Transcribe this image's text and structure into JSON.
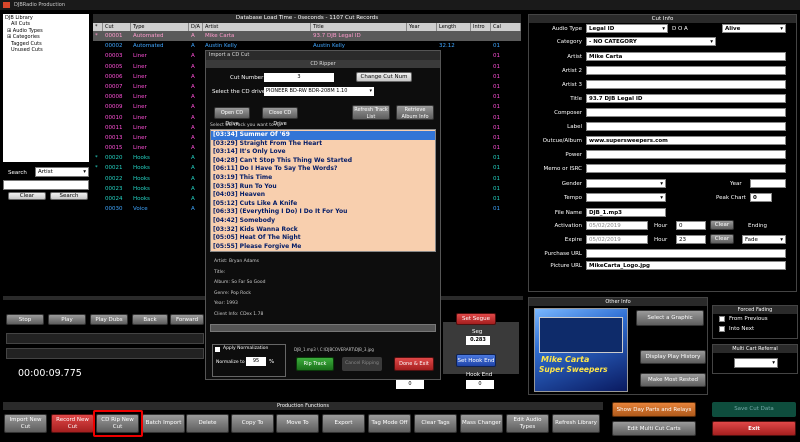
{
  "app": {
    "title": "DJBRadio Production"
  },
  "library": {
    "items": [
      "DJB Library",
      "All Cuts",
      "Audio Types",
      "Categories",
      "Tagged Cuts",
      "Unused Cuts"
    ],
    "search_label": "Search",
    "search_field": "Artist",
    "clear_label": "Clear",
    "search_button": "Search"
  },
  "main": {
    "header": "Database Load Time - 0seconds - 1107 Cut Records",
    "columns": [
      "*",
      "Cut",
      "Type",
      "D/A",
      "Artist",
      "Title",
      "Year",
      "Length",
      "Intro",
      "Cal"
    ],
    "rows": [
      {
        "flag": "*",
        "cut": "00001",
        "type": "Automated",
        "da": "A",
        "artist": "Mike Carta",
        "title": "93.7 DJB Legal ID",
        "year": "",
        "length": "",
        "intro": "",
        "cal": ""
      },
      {
        "flag": "",
        "cut": "00002",
        "type": "Automated",
        "da": "A",
        "artist": "Austin Kelly",
        "title": "Austin Kelly",
        "year": "",
        "length": "32.12",
        "intro": "",
        "cal": "01"
      },
      {
        "flag": "",
        "cut": "00003",
        "type": "Liner",
        "da": "A",
        "artist": "",
        "title": "",
        "year": "",
        "length": "",
        "intro": "",
        "cal": "01"
      },
      {
        "flag": "",
        "cut": "00005",
        "type": "Liner",
        "da": "A",
        "artist": "",
        "title": "",
        "year": "",
        "length": "",
        "intro": "",
        "cal": "01"
      },
      {
        "flag": "",
        "cut": "00006",
        "type": "Liner",
        "da": "A",
        "artist": "",
        "title": "",
        "year": "",
        "length": "",
        "intro": "",
        "cal": "01"
      },
      {
        "flag": "",
        "cut": "00007",
        "type": "Liner",
        "da": "A",
        "artist": "",
        "title": "",
        "year": "",
        "length": "",
        "intro": "",
        "cal": "01"
      },
      {
        "flag": "",
        "cut": "00008",
        "type": "Liner",
        "da": "A",
        "artist": "",
        "title": "",
        "year": "",
        "length": "",
        "intro": "",
        "cal": "01"
      },
      {
        "flag": "",
        "cut": "00009",
        "type": "Liner",
        "da": "A",
        "artist": "",
        "title": "",
        "year": "",
        "length": "",
        "intro": "",
        "cal": "01"
      },
      {
        "flag": "",
        "cut": "00010",
        "type": "Liner",
        "da": "A",
        "artist": "",
        "title": "",
        "year": "",
        "length": "",
        "intro": "",
        "cal": "01"
      },
      {
        "flag": "",
        "cut": "00011",
        "type": "Liner",
        "da": "A",
        "artist": "",
        "title": "",
        "year": "",
        "length": "",
        "intro": "",
        "cal": "01"
      },
      {
        "flag": "",
        "cut": "00013",
        "type": "Liner",
        "da": "A",
        "artist": "",
        "title": "",
        "year": "",
        "length": "",
        "intro": "",
        "cal": "01"
      },
      {
        "flag": "",
        "cut": "00015",
        "type": "Liner",
        "da": "A",
        "artist": "",
        "title": "",
        "year": "",
        "length": "",
        "intro": "",
        "cal": "01"
      },
      {
        "flag": "*",
        "cut": "00020",
        "type": "Hooks",
        "da": "A",
        "artist": "",
        "title": "",
        "year": "",
        "length": "",
        "intro": "",
        "cal": "01"
      },
      {
        "flag": "*",
        "cut": "00021",
        "type": "Hooks",
        "da": "A",
        "artist": "",
        "title": "",
        "year": "",
        "length": "",
        "intro": "",
        "cal": "01"
      },
      {
        "flag": "",
        "cut": "00022",
        "type": "Hooks",
        "da": "A",
        "artist": "",
        "title": "",
        "year": "",
        "length": "",
        "intro": "",
        "cal": "01"
      },
      {
        "flag": "",
        "cut": "00023",
        "type": "Hooks",
        "da": "A",
        "artist": "",
        "title": "",
        "year": "",
        "length": "",
        "intro": "",
        "cal": "01"
      },
      {
        "flag": "",
        "cut": "00024",
        "type": "Hooks",
        "da": "A",
        "artist": "",
        "title": "",
        "year": "",
        "length": "",
        "intro": "",
        "cal": "01"
      },
      {
        "flag": "",
        "cut": "00030",
        "type": "Voice",
        "da": "A",
        "artist": "",
        "title": "",
        "year": "",
        "length": "",
        "intro": "",
        "cal": "01"
      }
    ]
  },
  "ripper": {
    "window_title": "Import a CD Cut",
    "header": "CD Ripper",
    "cut_number_label": "Cut Number",
    "cut_number": "3",
    "change_cut_button": "Change Cut Num",
    "drive_label": "Select the CD drive",
    "drive": "PIONEER BD-RW  BDR-208M 1.10",
    "open_drive": "Open CD Drive",
    "close_drive": "Close CD Drive",
    "refresh_list": "Refresh Track List",
    "retrieve_info": "Retrieve Album Info",
    "select_prompt": "Select the track you want to rip",
    "tracks": [
      "[03:34] Summer Of '69",
      "[03:29] Straight From The Heart",
      "[03:14] It's Only Love",
      "[04:28] Can't Stop This Thing We Started",
      "[06:11] Do I Have To Say The Words?",
      "[03:19] This Time",
      "[03:53] Run To You",
      "[04:03] Heaven",
      "[05:12] Cuts Like A Knife",
      "[06:33] (Everything I Do) I Do It For You",
      "[04:42] Somebody",
      "[03:32] Kids Wanna Rock",
      "[05:05] Heat Of The Night",
      "[05:55] Please Forgive Me"
    ],
    "info": {
      "artist": "Artist: Bryan Adams",
      "title": "Title:",
      "album": "Album: So Far So Good",
      "genre": "Genre: Pop Rock",
      "year": "Year: 1993",
      "client": "Client Info: CDex 1.78"
    },
    "apply_norm": "Apply Normalization",
    "norm_label": "Normalize to",
    "norm_value": "95",
    "norm_unit": "%",
    "path": "DJB_1.mp3 \\ C:\\DJBCOVERART\\DJB_3.jpg",
    "rip_track": "Rip Track",
    "cancel_ripping": "Cancel Ripping",
    "done_exit": "Done & Exit"
  },
  "cutinfo": {
    "header": "Cut Info",
    "audio_type_label": "Audio Type",
    "audio_type": "Legal ID",
    "doa_label": "D O A",
    "doa": "Alive",
    "category_label": "Category",
    "category": "- NO CATEGORY",
    "artist_label": "Artist",
    "artist": "Mike Carta",
    "artist2_label": "Artist 2",
    "artist3_label": "Artist 3",
    "title_label": "Title",
    "title": "93.7 DJB Legal ID",
    "composer_label": "Composer",
    "label_label": "Label",
    "outcue_label": "Outcue/Album",
    "outcue": "www.supersweepers.com",
    "power_label": "Power",
    "memo_label": "Memo or ISRC",
    "gender_label": "Gender",
    "year_label": "Year",
    "tempo_label": "Tempo",
    "peak_label": "Peak Chart",
    "peak": "0",
    "filename_label": "File Name",
    "filename": "DJB_1.mp3",
    "activation_label": "Activation",
    "activation_date": "05/02/2019",
    "hour_label": "Hour",
    "activation_hour": "0",
    "clear_label": "Clear",
    "ending_label": "Ending",
    "expire_label": "Expire",
    "expire_date": "05/02/2019",
    "expire_hour": "23",
    "ending": "Fade",
    "purchase_label": "Purchase URL",
    "picture_label": "Picture URL",
    "picture": "MikeCarta_Logo.jpg"
  },
  "player": {
    "stop": "Stop",
    "play": "Play",
    "play_dubs": "Play Dubs",
    "back": "Back",
    "forward": "Forward",
    "time": "00:00:09.775",
    "set_segue": "Set Segue",
    "seg_label": "Seg",
    "seg_value": "0.283",
    "set_hook_end": "Set Hook End",
    "hook_end_label": "Hook End",
    "hook_end_value": "0",
    "extra_value": "0"
  },
  "other": {
    "header": "Other Info",
    "logo_line1": "Mike Carta",
    "logo_line2": "Super Sweepers",
    "select_graphic": "Select a Graphic",
    "play_history": "Display Play History",
    "most_rested": "Make Most Rested",
    "forced_fading": "Forced Fading",
    "from_previous": "From Previous",
    "into_next": "Into Next",
    "multi_cart": "Multi Cart Referral"
  },
  "production": {
    "header": "Production Functions",
    "buttons": [
      "Import New Cut",
      "Record New Cut",
      "CD Rip New Cut",
      "Batch Import",
      "Delete",
      "Copy To",
      "Move To",
      "Export",
      "Tag Mode Off",
      "Clear Tags",
      "Mass Changer",
      "Edit Audio Types",
      "Refresh Library"
    ],
    "day_parts": "Show Day Parts and Relays",
    "multi_carts": "Edit Multi Cut Carts",
    "save": "Save Cut Data",
    "exit": "Exit"
  }
}
